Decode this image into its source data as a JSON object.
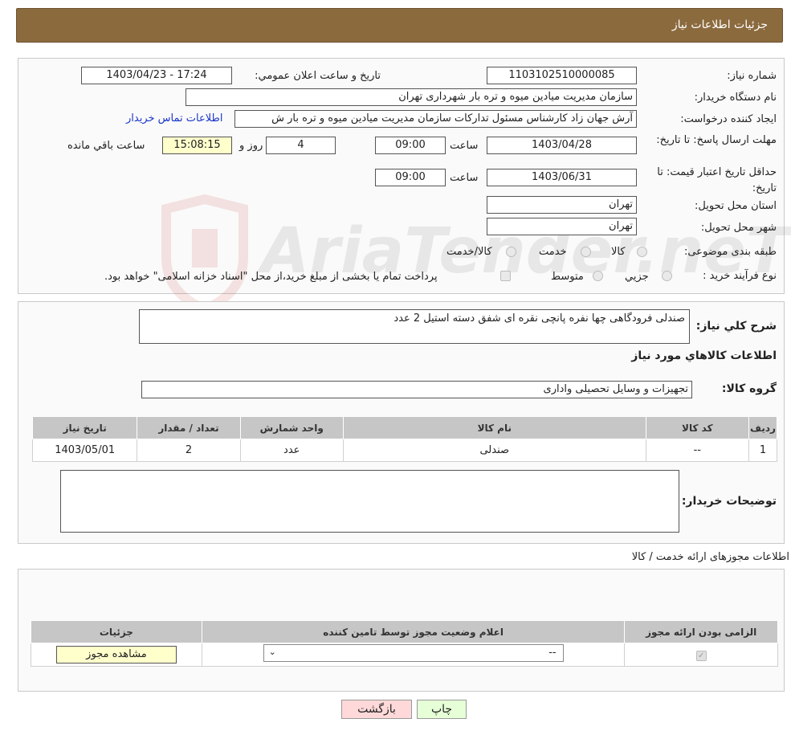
{
  "header": {
    "title": "جزئیات اطلاعات نیاز"
  },
  "fields": {
    "need_number_label": "شماره نیاز:",
    "need_number": "1103102510000085",
    "announce_label": "تاریخ و ساعت اعلان عمومي:",
    "announce_value": "1403/04/23 - 17:24",
    "buyer_org_label": "نام دستگاه خريدار:",
    "buyer_org": "سازمان مدیریت میادین میوه و تره بار شهرداری تهران",
    "creator_label": "ايجاد کننده درخواست:",
    "creator": "آرش جهان زاد کارشناس مسئول تدارکات سازمان مدیریت میادین میوه و تره بار ش",
    "buyer_contact_link": "اطلاعات تماس خريدار",
    "reply_deadline_label": "مهلت ارسال پاسخ: تا تاریخ:",
    "reply_date": "1403/04/28",
    "time_label": "ساعت",
    "reply_time": "09:00",
    "days_value": "4",
    "days_label": "روز و",
    "remaining_time": "15:08:15",
    "remaining_label": "ساعت باقي مانده",
    "price_validity_label": "حداقل تاريخ اعتبار قيمت: تا تاريخ:",
    "validity_date": "1403/06/31",
    "validity_time": "09:00",
    "province_label": "استان محل تحويل:",
    "province": "تهران",
    "city_label": "شهر محل تحويل:",
    "city": "تهران",
    "category_label": "طبقه بندی موضوعی:",
    "category_options": [
      "کالا",
      "خدمت",
      "کالا/خدمت"
    ],
    "process_label": "نوع فرآيند خريد :",
    "process_options": [
      "جزيي",
      "متوسط"
    ],
    "payment_note": "پرداخت تمام يا بخشی از مبلغ خريد،از محل \"اسناد خزانه اسلامی\" خواهد بود."
  },
  "description": {
    "label": "شرح کلي نياز:",
    "text": "صندلی فرودگاهی چها نفره پانچی نقره ای شفق دسته استیل 2 عدد",
    "goods_info_title": "اطلاعات کالاهاي مورد نياز",
    "goods_group_label": "گروه کالا:",
    "goods_group": "تجهیزات و وسایل تحصیلی واداری"
  },
  "items_table": {
    "headers": [
      "رديف",
      "کد کالا",
      "نام کالا",
      "واحد شمارش",
      "تعداد / مقدار",
      "تاريخ نياز"
    ],
    "rows": [
      [
        "1",
        "--",
        "صندلی",
        "عدد",
        "2",
        "1403/05/01"
      ]
    ]
  },
  "buyer_notes": {
    "label": "توضيحات خريدار:",
    "text": ""
  },
  "license": {
    "title": "اطلاعات مجوزهای ارائه خدمت / کالا",
    "headers": [
      "الزامی بودن ارائه مجوز",
      "اعلام وضعیت مجوز توسط تامین کننده",
      "جزئیات"
    ],
    "select_value": "--",
    "view_button": "مشاهده مجوز"
  },
  "buttons": {
    "print": "چاپ",
    "back": "بازگشت"
  },
  "watermark": {
    "text": "AriaTender.neT"
  },
  "colors": {
    "header": "#8b6a3e",
    "back_button": "#ffd9d9",
    "print_button": "#e6ffd6",
    "link": "#1a35c9"
  }
}
